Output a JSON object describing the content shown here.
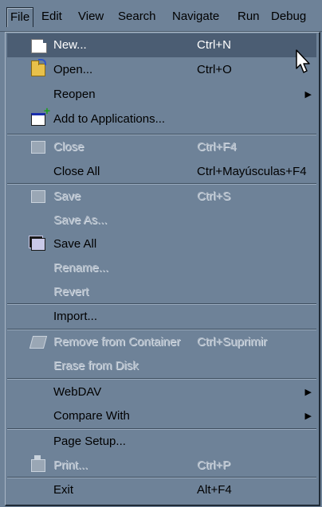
{
  "menubar": {
    "items": [
      {
        "label": "File",
        "mnemonic": "F"
      },
      {
        "label": "Edit",
        "mnemonic": "E"
      },
      {
        "label": "View",
        "mnemonic": "V"
      },
      {
        "label": "Search",
        "mnemonic": "S"
      },
      {
        "label": "Navigate",
        "mnemonic": "N"
      },
      {
        "label": "Run",
        "mnemonic": "R"
      },
      {
        "label": "Debug",
        "mnemonic": "D"
      }
    ]
  },
  "file_menu": {
    "items": [
      {
        "label": "New...",
        "accel": "Ctrl+N",
        "icon": "new-file-icon",
        "state": "highlighted"
      },
      {
        "label": "Open...",
        "accel": "Ctrl+O",
        "icon": "open-folder-icon",
        "state": "enabled"
      },
      {
        "label": "Reopen",
        "accel": "",
        "icon": "",
        "state": "enabled",
        "submenu": true
      },
      {
        "label": "Add to Applications...",
        "accel": "",
        "icon": "add-application-icon",
        "state": "enabled"
      },
      {
        "label": "Close",
        "accel": "Ctrl+F4",
        "icon": "close-file-icon",
        "state": "disabled"
      },
      {
        "label": "Close All",
        "accel": "Ctrl+Mayúsculas+F4",
        "icon": "",
        "state": "enabled"
      },
      {
        "label": "Save",
        "accel": "Ctrl+S",
        "icon": "save-disk-icon",
        "state": "disabled"
      },
      {
        "label": "Save As...",
        "accel": "",
        "icon": "",
        "state": "disabled"
      },
      {
        "label": "Save All",
        "accel": "",
        "icon": "save-all-icon",
        "state": "enabled"
      },
      {
        "label": "Rename...",
        "accel": "",
        "icon": "",
        "state": "disabled"
      },
      {
        "label": "Revert",
        "accel": "",
        "icon": "",
        "state": "disabled"
      },
      {
        "label": "Import...",
        "accel": "",
        "icon": "",
        "state": "enabled"
      },
      {
        "label": "Remove from Container",
        "accel": "Ctrl+Suprimir",
        "icon": "remove-icon",
        "state": "disabled"
      },
      {
        "label": "Erase from Disk",
        "accel": "",
        "icon": "",
        "state": "disabled"
      },
      {
        "label": "WebDAV",
        "accel": "",
        "icon": "",
        "state": "enabled",
        "submenu": true
      },
      {
        "label": "Compare With",
        "accel": "",
        "icon": "",
        "state": "enabled",
        "submenu": true
      },
      {
        "label": "Page Setup...",
        "accel": "",
        "icon": "",
        "state": "enabled"
      },
      {
        "label": "Print...",
        "accel": "Ctrl+P",
        "icon": "printer-icon",
        "state": "disabled"
      },
      {
        "label": "Exit",
        "accel": "Alt+F4",
        "icon": "",
        "state": "enabled"
      }
    ],
    "submenu_arrow": "▶"
  },
  "colors": {
    "menu_bg": "#6e8298",
    "highlight": "#4b5d73",
    "disabled_text": "#aeb9c6"
  }
}
